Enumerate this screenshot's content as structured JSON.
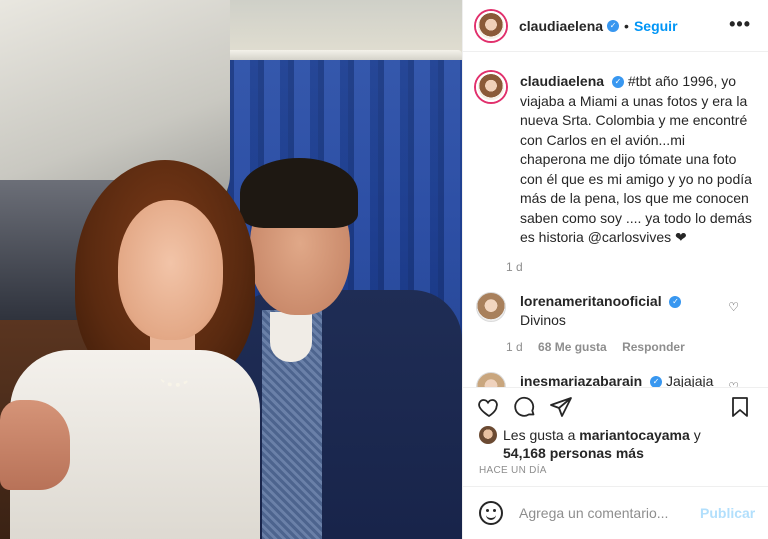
{
  "post": {
    "author": "claudiaelena",
    "verified": true,
    "follow_label": "Seguir",
    "dot": "•",
    "more_label": "•••"
  },
  "caption": {
    "username": "claudiaelena",
    "text": "#tbt año 1996, yo viajaba a Miami a unas fotos y era la nueva Srta. Colombia y me encontré con Carlos en el avión...mi chaperona me dijo tómate una foto con él que es mi amigo y yo no podía más de la pena, los que me conocen saben como soy .... ya todo lo demás es historia @carlosvives ❤",
    "time": "1 d"
  },
  "comments": [
    {
      "username": "lorenameritanooficial",
      "verified": true,
      "text": "Divinos",
      "time": "1 d",
      "likes": "68 Me gusta",
      "reply_label": "Responder"
    },
    {
      "username": "inesmariazabarain",
      "verified": true,
      "text": "Jajajaja que belleza!!"
    }
  ],
  "likes": {
    "prefix": "Les gusta a",
    "user": "mariantocayama",
    "conjunction": "y",
    "others": "54,168 personas más"
  },
  "ago": "HACE UN DÍA",
  "composer": {
    "placeholder": "Agrega un comentario...",
    "publish_label": "Publicar"
  },
  "icons": {
    "heart": "heart-icon",
    "comment": "comment-icon",
    "share": "share-icon",
    "save": "bookmark-icon",
    "emoji": "emoji-icon"
  },
  "colors": {
    "link_blue": "#0095f6",
    "verified_blue": "#3897f0",
    "muted": "#8e8e8e",
    "publish_disabled": "#b2dffc"
  }
}
